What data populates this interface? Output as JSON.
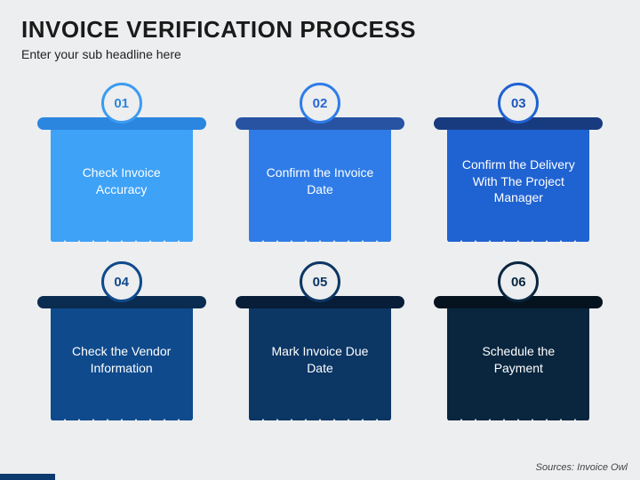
{
  "title": "INVOICE VERIFICATION PROCESS",
  "subtitle": "Enter your sub headline here",
  "steps": [
    {
      "num": "01",
      "label": "Check Invoice Accuracy"
    },
    {
      "num": "02",
      "label": "Confirm the Invoice Date"
    },
    {
      "num": "03",
      "label": "Confirm the Delivery With The Project Manager"
    },
    {
      "num": "04",
      "label": "Check the Vendor Information"
    },
    {
      "num": "05",
      "label": "Mark Invoice Due Date"
    },
    {
      "num": "06",
      "label": "Schedule the Payment"
    }
  ],
  "source": "Sources: Invoice Owl"
}
